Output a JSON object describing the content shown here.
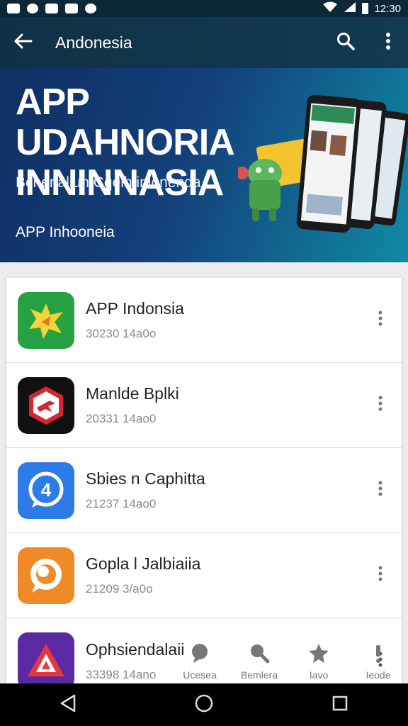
{
  "status": {
    "time": "12:30"
  },
  "toolbar": {
    "title": "Andonesia",
    "back_icon": "arrow-left-icon",
    "search_icon": "search-icon",
    "menu_icon": "more-vert-icon"
  },
  "hero": {
    "title": "APP UDAHNORIA INNINNASIA",
    "subtitle": "Bcherlaliun Cqelh inlonenda",
    "brand": "APP Inhooneia"
  },
  "apps": [
    {
      "name": "APP Indonsia",
      "meta": "30230 14a0o",
      "color": "#27a243"
    },
    {
      "name": "Manlde Bplki",
      "meta": "20331 14ao0",
      "color": "#111111"
    },
    {
      "name": "Sbies n Caphitta",
      "meta": "21237 14ao0",
      "color": "#2d7be6"
    },
    {
      "name": "Gopla l Jalbiaiia",
      "meta": "21209 3/a0o",
      "color": "#ef8a26"
    },
    {
      "name": "Ophsiendalaii",
      "meta": "33398 14ano",
      "color": "#5b2aa3"
    }
  ],
  "bottom_nav": [
    {
      "label": "Ucesea",
      "icon": "chat-icon"
    },
    {
      "label": "Bemlera",
      "icon": "search-icon"
    },
    {
      "label": "Iavo",
      "icon": "star-icon"
    },
    {
      "label": "Ieode",
      "icon": "info-icon"
    }
  ],
  "colors": {
    "toolbar": "#0f3146",
    "hero_start": "#0e2f63",
    "hero_end": "#0f8aa5"
  }
}
